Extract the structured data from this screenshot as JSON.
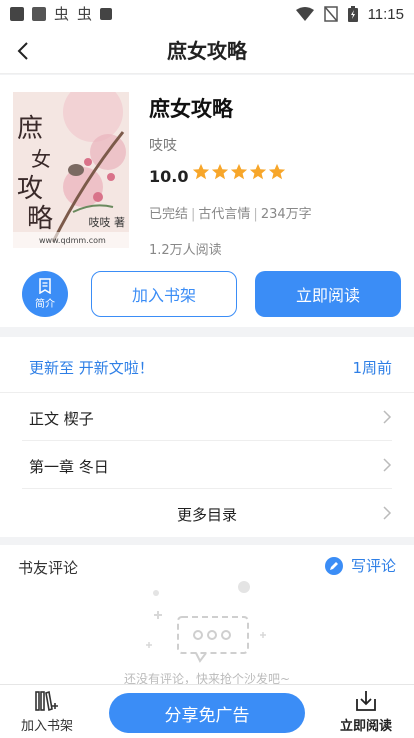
{
  "status_bar": {
    "time": "11:15"
  },
  "header": {
    "title": "庶女攻略"
  },
  "book": {
    "title": "庶女攻略",
    "author": "吱吱",
    "score": "10.0",
    "rating_stars": 5,
    "status": "已完结",
    "category": "古代言情",
    "word_count": "234万字",
    "readers": "1.2万人阅读",
    "cover": {
      "title_chars": [
        "庶",
        "女",
        "攻",
        "略"
      ],
      "author_line": "吱吱 著",
      "site": "www.qdmm.com"
    }
  },
  "actions": {
    "intro_label": "简介",
    "add_shelf_label": "加入书架",
    "read_now_label": "立即阅读"
  },
  "catalog": {
    "update_text": "更新至 开新文啦！",
    "update_time": "1周前",
    "chapters": [
      {
        "label": "正文 楔子"
      },
      {
        "label": "第一章 冬日"
      }
    ],
    "more_label": "更多目录"
  },
  "comments": {
    "title": "书友评论",
    "write_label": "写评论",
    "empty_text": "还没有评论，快来抢个沙发吧~"
  },
  "bottom_bar": {
    "shelf_label": "加入书架",
    "share_label": "分享免广告",
    "read_label": "立即阅读"
  },
  "colors": {
    "accent": "#3b8df6",
    "star": "#f7a62a"
  }
}
